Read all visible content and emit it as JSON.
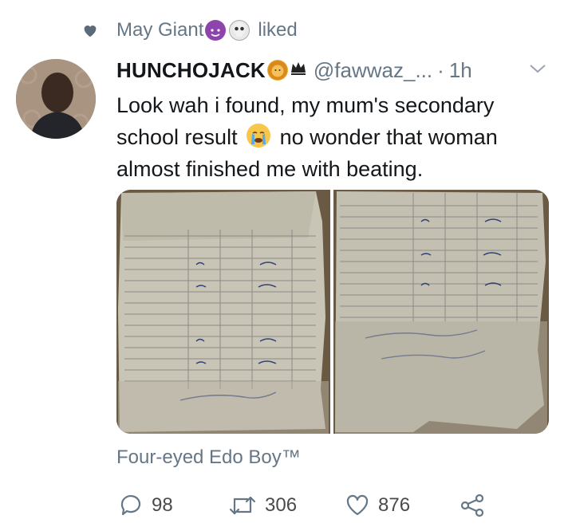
{
  "liked": {
    "user": "May Giant",
    "suffix": "liked"
  },
  "tweet": {
    "display_name": "HUNCHOJACK",
    "handle": "@fawwaz_...",
    "separator": "·",
    "time": "1h",
    "text_line1": "Look wah i found, my mum's secondary",
    "text_line2a": "school result",
    "text_line2b": "no wonder that woman",
    "text_line3": "almost finished me with beating."
  },
  "footer": {
    "name": "Four-eyed Edo Boy™"
  },
  "actions": {
    "replies": "98",
    "retweets": "306",
    "likes": "876"
  },
  "colors": {
    "secondary_text": "#657786",
    "heart": "#657786"
  }
}
